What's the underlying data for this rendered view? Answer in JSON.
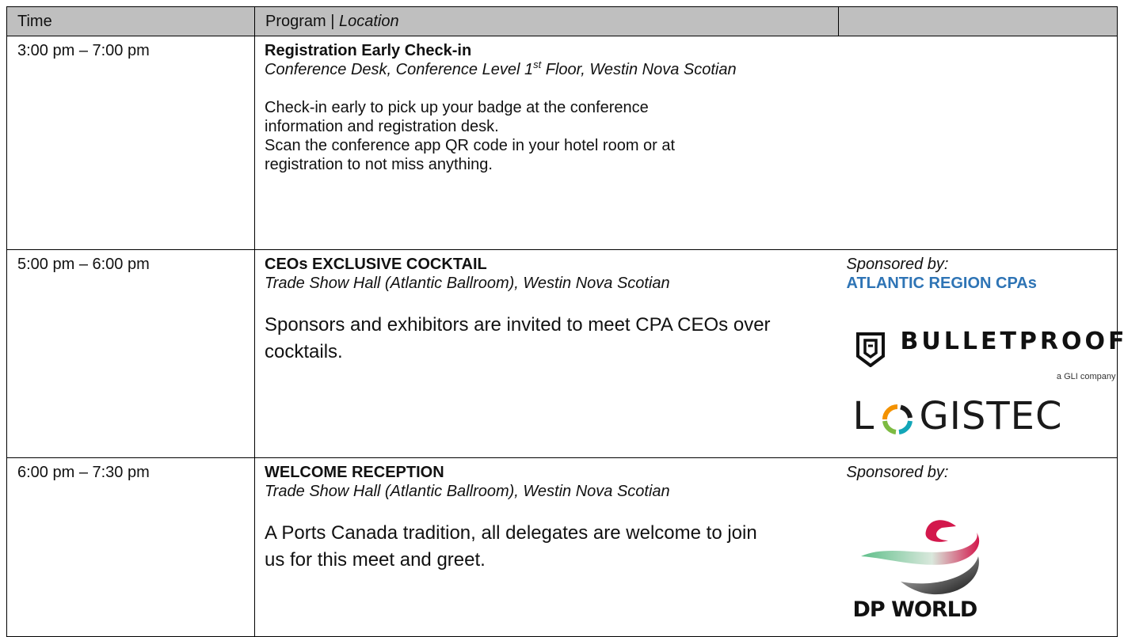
{
  "header": {
    "time_label": "Time",
    "program_label": "Program | ",
    "location_label": "Location"
  },
  "rows": [
    {
      "time": "3:00 pm – 7:00 pm",
      "title": "Registration Early Check-in",
      "location_pre": "Conference Desk, Conference Level 1",
      "location_sup": "st",
      "location_post": " Floor, Westin Nova Scotian",
      "desc_lines": [
        "Check-in early to pick up your badge at the conference",
        "information and registration desk.",
        "Scan the conference app QR code in your hotel room or at",
        "registration to not miss anything."
      ]
    },
    {
      "time": "5:00 pm – 6:00 pm",
      "title": "CEOs EXCLUSIVE COCKTAIL",
      "location": "Trade Show Hall (Atlantic Ballroom), Westin Nova Scotian",
      "desc_lines": [
        "Sponsors and exhibitors are invited to meet CPA CEOs over",
        "cocktails."
      ],
      "sponsor_label": "Sponsored by:",
      "sponsor_name": "ATLANTIC REGION CPAs",
      "logos": [
        {
          "name": "BULLETPROOF",
          "tagline": "a GLI company",
          "icon": "bulletproof-shield-icon"
        },
        {
          "first": "L",
          "rest": "GISTEC",
          "icon": "logistec-ring-icon"
        }
      ]
    },
    {
      "time": "6:00 pm – 7:30 pm",
      "title": "WELCOME RECEPTION",
      "location": "Trade Show Hall (Atlantic Ballroom), Westin Nova Scotian",
      "desc_lines": [
        "A Ports Canada tradition, all delegates are welcome to join",
        "us for this meet and greet."
      ],
      "sponsor_label": "Sponsored by:",
      "logos": [
        {
          "name": "DP WORLD",
          "icon": "dp-world-swoosh-icon"
        }
      ]
    }
  ],
  "colors": {
    "header_bg": "#bfbfbf",
    "sponsor_blue": "#2e74b5",
    "logistec_orange": "#f39200",
    "logistec_green": "#7dbb42",
    "logistec_teal": "#12a6b8",
    "dp_red": "#d3184c",
    "dp_green": "#5fbf8a"
  }
}
